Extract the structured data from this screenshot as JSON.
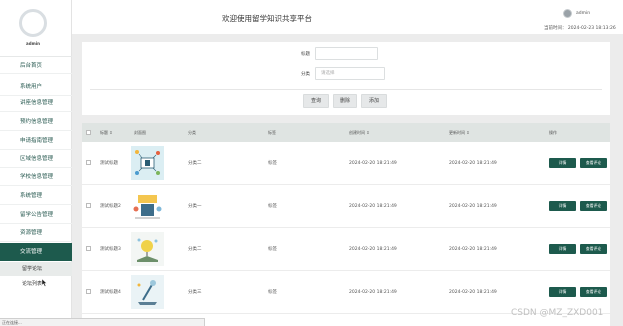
{
  "header": {
    "title": "欢迎使用留学知识共享平台",
    "user_name": "admin",
    "time_label": "当前时间：  2024-02-23 18:13:26"
  },
  "sidebar": {
    "admin_name": "admin",
    "items": [
      {
        "label": "后台首页"
      },
      {
        "label": "系统用户"
      },
      {
        "label": "讲座信息管理"
      },
      {
        "label": "预约信息管理"
      },
      {
        "label": "申请指南管理"
      },
      {
        "label": "区域信息管理"
      },
      {
        "label": "学校信息管理"
      },
      {
        "label": "系统管理"
      },
      {
        "label": "留学公告管理"
      },
      {
        "label": "资源管理"
      },
      {
        "label": "交流管理"
      }
    ],
    "sub_items": [
      {
        "label": "留学论坛"
      },
      {
        "label": "论坛列表"
      }
    ]
  },
  "search": {
    "title_label": "标题",
    "title_value": "",
    "category_label": "分类",
    "category_placeholder": "请选择",
    "query_button": "查询",
    "delete_button": "删除",
    "add_button": "添加"
  },
  "table": {
    "headers": {
      "title": "标题 ⇕",
      "cover": "封面图",
      "category": "分类",
      "tag": "标签",
      "created": "创建时间 ⇕",
      "updated": "更新时间 ⇕",
      "action": "操作"
    },
    "rows": [
      {
        "title": "测试标题",
        "category": "分类二",
        "tag": "标签",
        "created": "2024-02-20 18:21:49",
        "updated": "2024-02-20 18:21:49",
        "detail": "详情",
        "comments": "查看评论"
      },
      {
        "title": "测试标题2",
        "category": "分类一",
        "tag": "标签",
        "created": "2024-02-20 18:21:49",
        "updated": "2024-02-20 18:21:49",
        "detail": "详情",
        "comments": "查看评论"
      },
      {
        "title": "测试标题3",
        "category": "分类二",
        "tag": "标签",
        "created": "2024-02-20 18:21:49",
        "updated": "2024-02-20 18:21:49",
        "detail": "详情",
        "comments": "查看评论"
      },
      {
        "title": "测试标题4",
        "category": "分类三",
        "tag": "标签",
        "created": "2024-02-20 18:21:49",
        "updated": "2024-02-20 18:21:49",
        "detail": "详情",
        "comments": "查看评论"
      }
    ]
  },
  "status_bar": "正在连接...",
  "watermark": "CSDN @MZ_ZXD001",
  "colors": {
    "accent": "#1d5a4d",
    "nav_text": "#2a5b52",
    "content_bg": "#ececec",
    "table_header_bg": "#dfe4e2"
  },
  "icons": {
    "avatar": "avatar-ring-icon",
    "user": "user-avatar-icon",
    "cursor": "mouse-pointer-icon"
  }
}
